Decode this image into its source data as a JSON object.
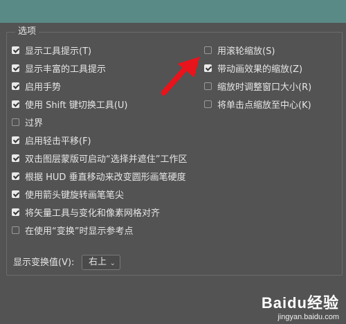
{
  "dialog": {
    "group_title": "选项",
    "left_options": [
      {
        "label": "显示工具提示(T)",
        "checked": true
      },
      {
        "label": "显示丰富的工具提示",
        "checked": true
      },
      {
        "label": "启用手势",
        "checked": true
      },
      {
        "label": "使用 Shift 键切换工具(U)",
        "checked": true
      },
      {
        "label": "过界",
        "checked": false
      },
      {
        "label": "启用轻击平移(F)",
        "checked": true
      },
      {
        "label": "双击图层蒙版可启动“选择并遮住”工作区",
        "checked": true
      },
      {
        "label": "根据 HUD 垂直移动来改变圆形画笔硬度",
        "checked": true
      },
      {
        "label": "使用箭头键旋转画笔笔尖",
        "checked": true
      },
      {
        "label": "将矢量工具与变化和像素网格对齐",
        "checked": true
      },
      {
        "label": "在使用“变换”时显示参考点",
        "checked": false
      }
    ],
    "right_options": [
      {
        "label": "用滚轮缩放(S)",
        "checked": false
      },
      {
        "label": "带动画效果的缩放(Z)",
        "checked": true
      },
      {
        "label": "缩放时调整窗口大小(R)",
        "checked": false
      },
      {
        "label": "将单击点缩放至中心(K)",
        "checked": false
      }
    ],
    "transform_label": "显示变换值(V):",
    "transform_value": "右上"
  },
  "watermark": {
    "logo_text": "Baidu经验",
    "url": "jingyan.baidu.com"
  },
  "colors": {
    "background": "#535353",
    "header_band": "#5a8a86",
    "annotation_arrow": "#e8141c"
  },
  "icons": {
    "dropdown": "chevron-down-icon",
    "annotation": "red-arrow-icon"
  }
}
